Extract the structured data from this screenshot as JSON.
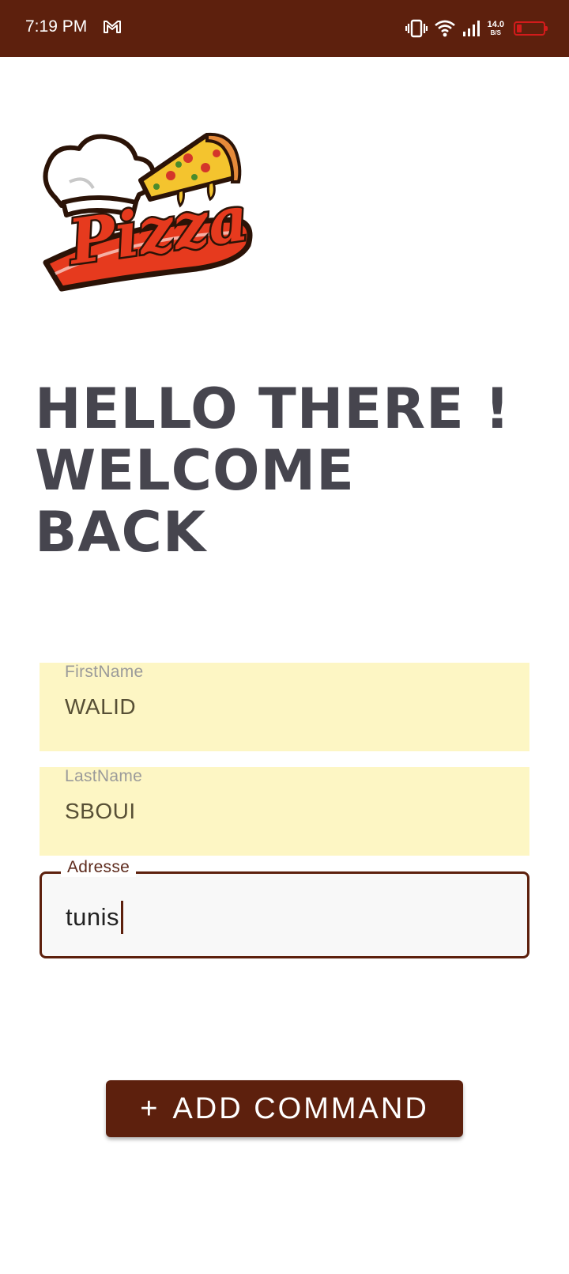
{
  "status_bar": {
    "time": "7:19 PM",
    "notification_icon": "gmail-icon",
    "net_speed_value": "14.0",
    "net_speed_unit": "B/S",
    "icons": [
      "vibrate-icon",
      "wifi-icon",
      "signal-icon",
      "battery-icon"
    ],
    "battery_color": "#d21b1b",
    "background": "#5d200d"
  },
  "logo": {
    "text": "Pizza"
  },
  "welcome": {
    "line1": "HELLO THERE !",
    "line2": "WELCOME",
    "line3": "BACK"
  },
  "form": {
    "first_name": {
      "label": "FirstName",
      "value": "WALID"
    },
    "last_name": {
      "label": "LastName",
      "value": "SBOUI"
    },
    "address": {
      "label": "Adresse",
      "value": "tunis"
    }
  },
  "actions": {
    "add_command_icon": "+",
    "add_command_label": "ADD COMMAND"
  },
  "colors": {
    "primary": "#5d200d",
    "filled_field_bg": "#fdf6c4",
    "heading": "#46454e"
  }
}
